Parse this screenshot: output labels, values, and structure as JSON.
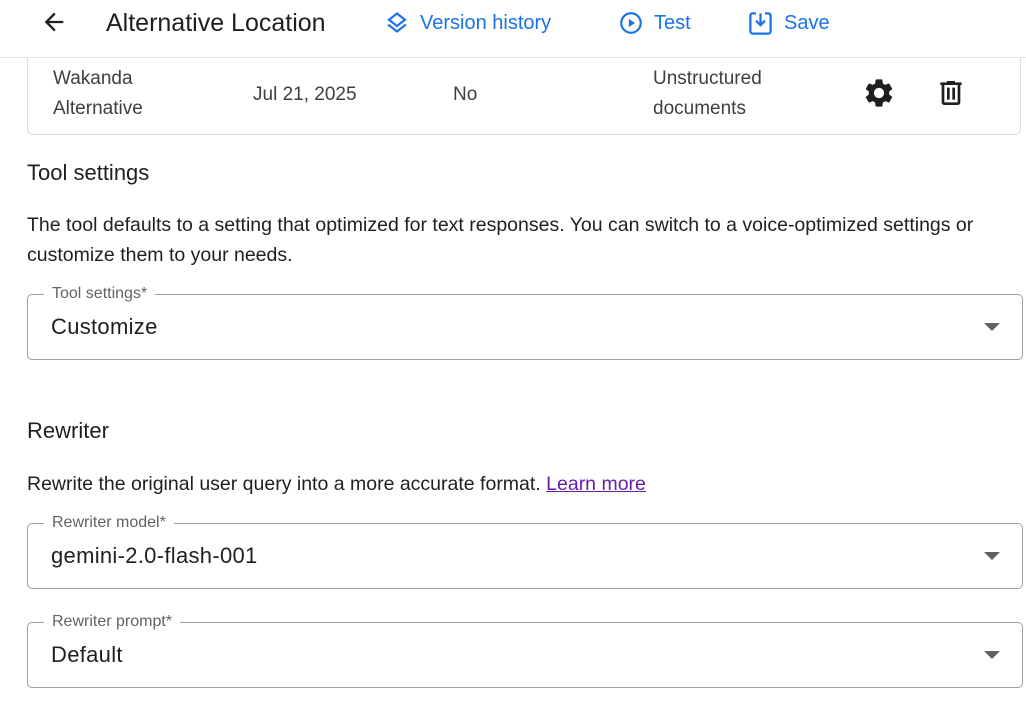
{
  "header": {
    "title": "Alternative Location",
    "actions": {
      "version_history": "Version history",
      "test": "Test",
      "save": "Save"
    }
  },
  "data_store_row": {
    "name": "Wakanda Alternative",
    "date": "Jul 21, 2025",
    "flag": "No",
    "type": "Unstructured documents"
  },
  "tool_settings": {
    "heading": "Tool settings",
    "description": "The tool defaults to a setting that optimized for text responses. You can switch to a voice-optimized settings or customize them to your needs.",
    "field_label": "Tool settings*",
    "value": "Customize"
  },
  "rewriter": {
    "heading": "Rewriter",
    "description": "Rewrite the original user query into a more accurate format.",
    "learn_more": "Learn more",
    "model_label": "Rewriter model*",
    "model_value": "gemini-2.0-flash-001",
    "prompt_label": "Rewriter prompt*",
    "prompt_value": "Default"
  },
  "colors": {
    "accent": "#1a73e8",
    "link_visited": "#681da8",
    "border": "#9aa0a6"
  },
  "icons": [
    "arrow-back-icon",
    "layers-icon",
    "play-circle-icon",
    "save-icon",
    "settings-gear-icon",
    "trash-icon",
    "dropdown-arrow-icon"
  ]
}
